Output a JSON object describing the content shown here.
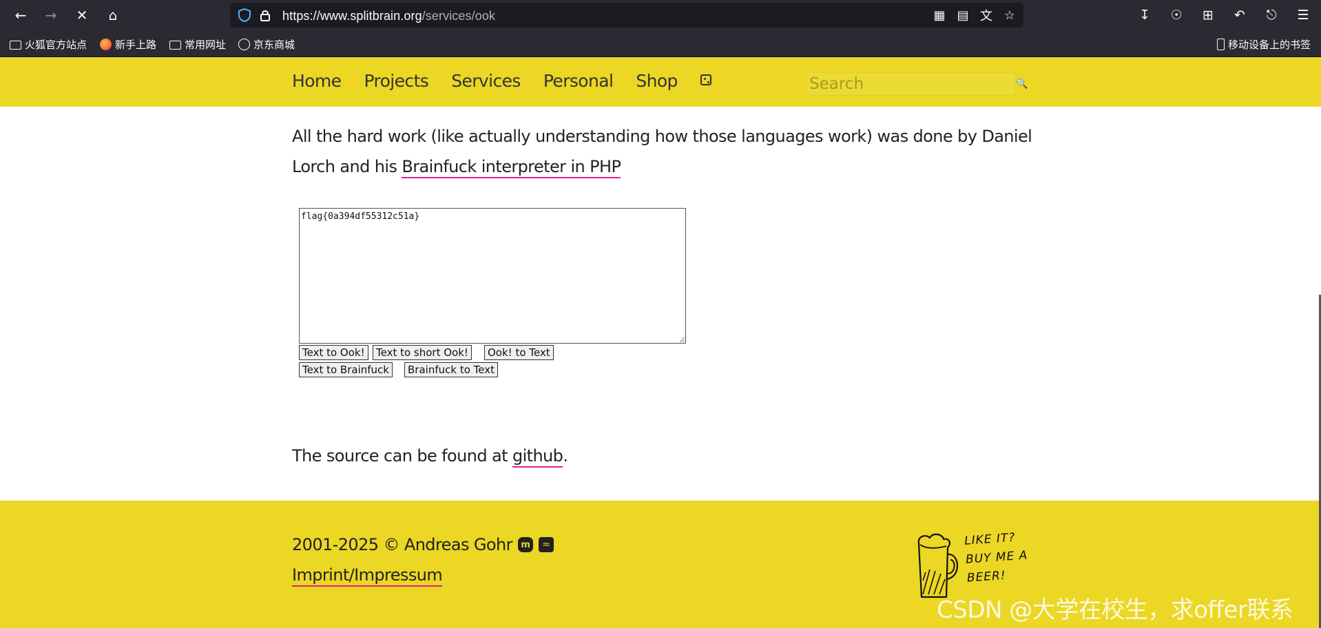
{
  "browser": {
    "url_host": "https://www.splitbrain.org",
    "url_path": "/services/ook",
    "bookmarks": [
      {
        "label": "火狐官方站点",
        "icon": "folder-icon"
      },
      {
        "label": "新手上路",
        "icon": "firefox-icon"
      },
      {
        "label": "常用网址",
        "icon": "folder-icon"
      },
      {
        "label": "京东商城",
        "icon": "globe-icon"
      }
    ],
    "mobile_bookmarks": "移动设备上的书签"
  },
  "nav": {
    "items": [
      "Home",
      "Projects",
      "Services",
      "Personal",
      "Shop"
    ],
    "search_placeholder": "Search"
  },
  "content": {
    "intro_text": "All the hard work (like actually understanding how those languages work) was done by Daniel Lorch and his ",
    "intro_link": "Brainfuck interpreter in PHP",
    "textarea_value": "flag{0a394df55312c51a}",
    "buttons": {
      "text_to_ook": "Text to Ook!",
      "text_to_short_ook": "Text to short Ook!",
      "ook_to_text": "Ook! to Text",
      "text_to_brainfuck": "Text to Brainfuck",
      "brainfuck_to_text": "Brainfuck to Text"
    },
    "source_text": "The source can be found at ",
    "source_link": "github",
    "source_end": "."
  },
  "footer": {
    "copyright": "2001-2025 © Andreas Gohr",
    "imprint": "Imprint/Impressum",
    "beer_text": "LIKE IT? BUY ME A BEER!"
  },
  "watermark": "CSDN @大学在校生，求offer联系",
  "colors": {
    "brand_yellow": "#ebd724",
    "link_underline": "#e01e8a",
    "chrome_bg": "#2b2a33"
  }
}
